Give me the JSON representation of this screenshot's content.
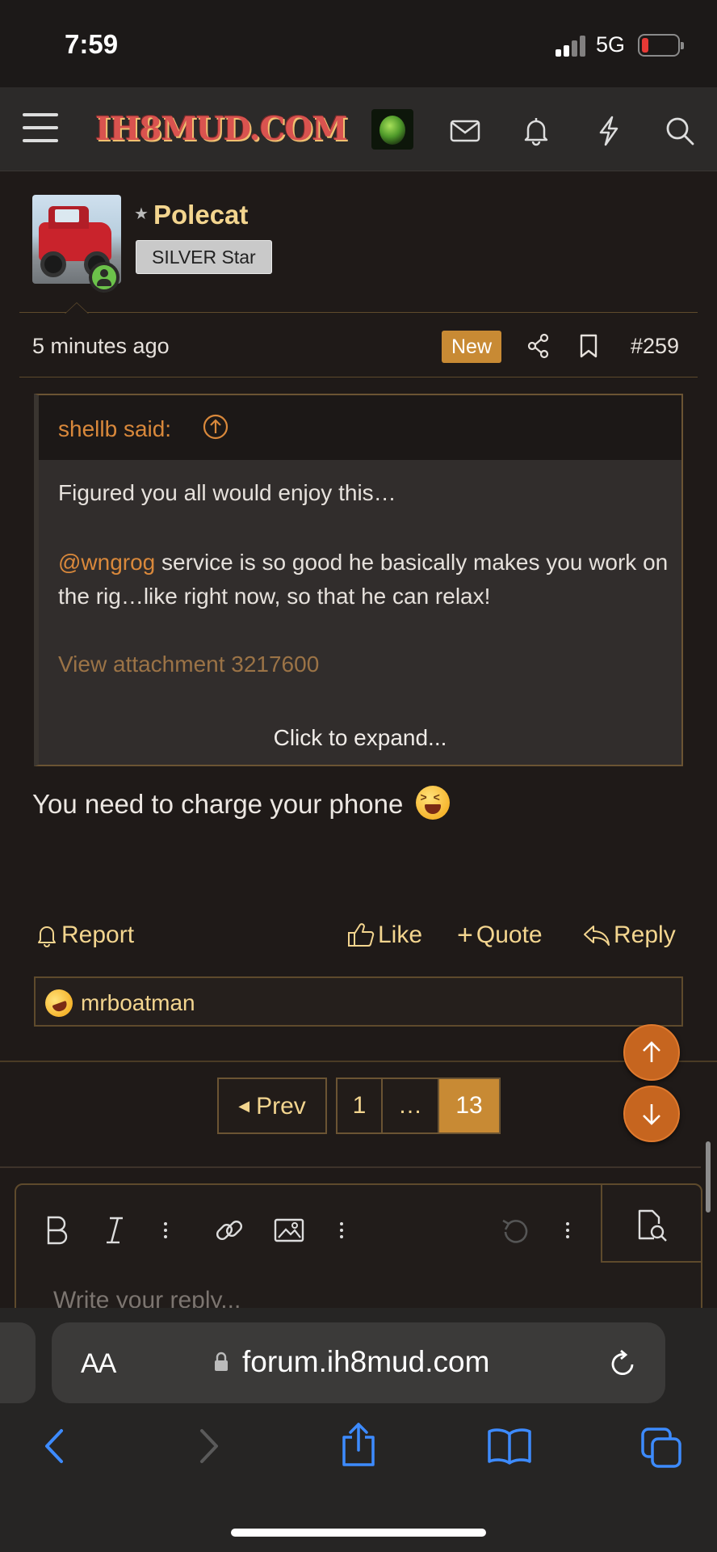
{
  "status_bar": {
    "time": "7:59",
    "network": "5G"
  },
  "nav": {
    "logo_text": "IH8MUD.COM"
  },
  "post": {
    "username": "Polecat",
    "user_title": "SILVER Star",
    "time": "5 minutes ago",
    "new_badge": "New",
    "post_number": "#259",
    "quote": {
      "author_label": "shellb said:",
      "line1": "Figured you all would enjoy this…",
      "mention": "@wngrog",
      "line2_rest": " service is so good he basically makes you work on the rig…like right now, so that he can relax!",
      "attachment": "View attachment 3217600",
      "expand_label": "Click to expand..."
    },
    "body": "You need to charge your phone",
    "actions": {
      "report": "Report",
      "like": "Like",
      "quote": "Quote",
      "reply": "Reply"
    },
    "reaction_user": "mrboatman"
  },
  "pagination": {
    "prev": "Prev",
    "first": "1",
    "ellipsis": "…",
    "current": "13"
  },
  "editor": {
    "placeholder": "Write your reply..."
  },
  "browser": {
    "aa": "AA",
    "url": "forum.ih8mud.com"
  }
}
